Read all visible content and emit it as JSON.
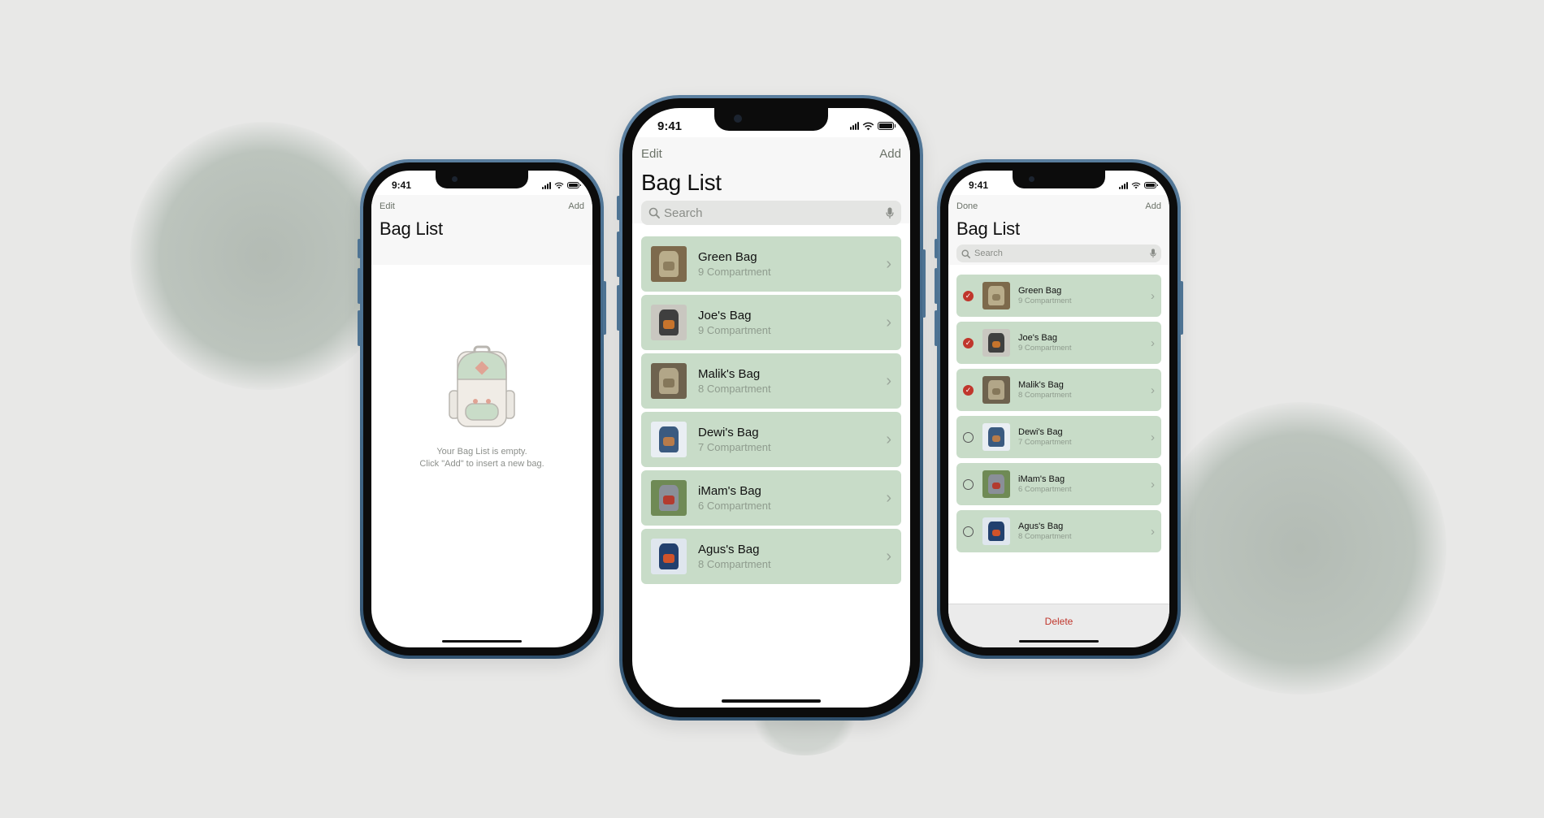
{
  "status": {
    "time": "9:41"
  },
  "screen_empty": {
    "nav_left": "Edit",
    "nav_right": "Add",
    "title": "Bag List",
    "empty_line1": "Your Bag List is empty.",
    "empty_line2": "Click \"Add\" to insert a new bag."
  },
  "screen_list": {
    "nav_left": "Edit",
    "nav_right": "Add",
    "title": "Bag List",
    "search_placeholder": "Search",
    "bags": [
      {
        "name": "Green Bag",
        "sub": "9 Compartment"
      },
      {
        "name": "Joe's Bag",
        "sub": "9 Compartment"
      },
      {
        "name": "Malik's Bag",
        "sub": "8 Compartment"
      },
      {
        "name": "Dewi's Bag",
        "sub": "7 Compartment"
      },
      {
        "name": "iMam's Bag",
        "sub": "6 Compartment"
      },
      {
        "name": "Agus's Bag",
        "sub": "8 Compartment"
      }
    ]
  },
  "screen_edit": {
    "nav_left": "Done",
    "nav_right": "Add",
    "title": "Bag List",
    "search_placeholder": "Search",
    "delete_label": "Delete",
    "bags": [
      {
        "name": "Green Bag",
        "sub": "9 Compartment",
        "selected": true
      },
      {
        "name": "Joe's Bag",
        "sub": "9 Compartment",
        "selected": true
      },
      {
        "name": "Malik's Bag",
        "sub": "8 Compartment",
        "selected": true
      },
      {
        "name": "Dewi's Bag",
        "sub": "7 Compartment",
        "selected": false
      },
      {
        "name": "iMam's Bag",
        "sub": "6 Compartment",
        "selected": false
      },
      {
        "name": "Agus's Bag",
        "sub": "8 Compartment",
        "selected": false
      }
    ]
  },
  "colors": {
    "row_bg": "#c8dcc8",
    "nav_link": "#6b7268",
    "delete_red": "#c0362c",
    "phone_frame": "#4e7393"
  },
  "icons": {
    "chevron": "›",
    "check": "✓",
    "search": "search-icon",
    "mic": "microphone-icon"
  }
}
